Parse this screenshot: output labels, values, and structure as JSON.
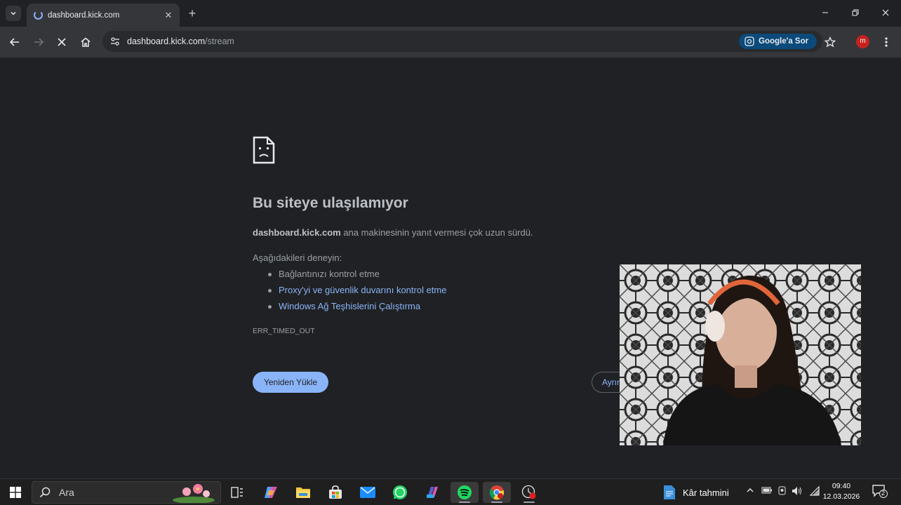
{
  "browser": {
    "tab_title": "dashboard.kick.com",
    "url_host": "dashboard.kick.com",
    "url_path": "/stream",
    "ask_google_label": "Google'a Sor",
    "profile_initial": "m"
  },
  "error_page": {
    "title": "Bu siteye ulaşılamıyor",
    "desc_host": "dashboard.kick.com",
    "desc_text": " ana makinesinin yanıt vermesi çok uzun sürdü.",
    "try_label": "Aşağıdakileri deneyin:",
    "suggestions": [
      "Bağlantınızı kontrol etme",
      "Proxy'yi ve güvenlik duvarını kontrol etme",
      "Windows Ağ Teşhislerini Çalıştırma"
    ],
    "error_code": "ERR_TIMED_OUT",
    "reload_label": "Yeniden Yükle",
    "details_label": "Ayrıntılar"
  },
  "taskbar": {
    "search_placeholder": "Ara",
    "widget_label": "Kâr tahmini",
    "time": "09:40",
    "date": "12.03.2026",
    "notification_count": "2"
  },
  "colors": {
    "accent": "#8ab4f8",
    "page_bg": "#202124",
    "toolbar_bg": "#35363a"
  }
}
